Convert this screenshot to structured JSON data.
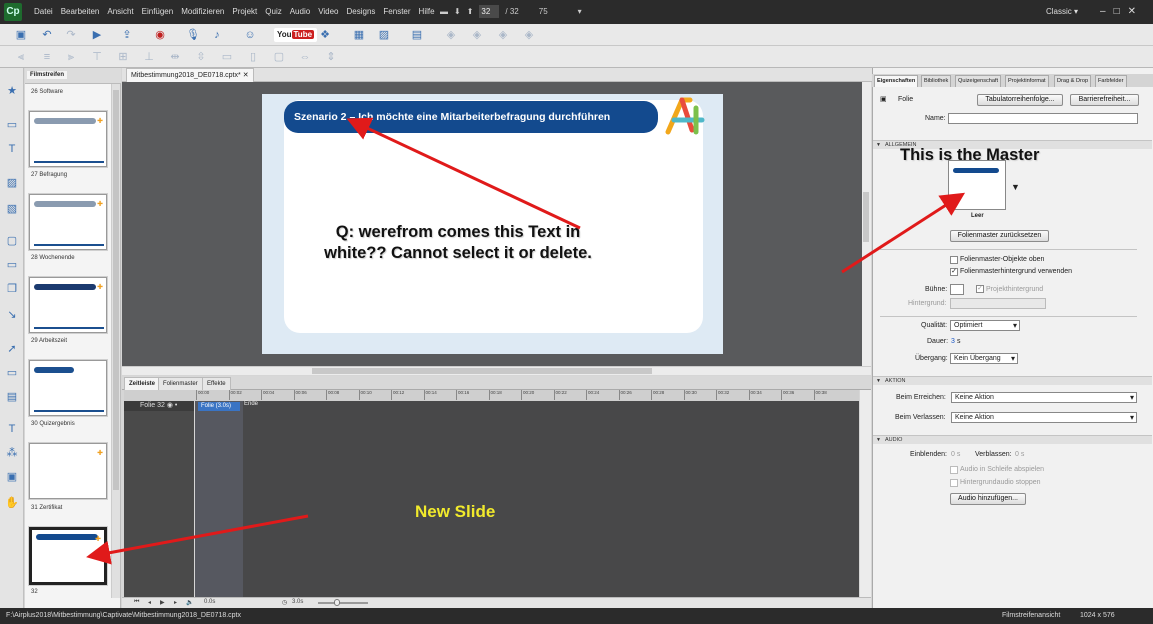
{
  "app": {
    "logo": "Cp",
    "menu": [
      "Datei",
      "Bearbeiten",
      "Ansicht",
      "Einfügen",
      "Modifizieren",
      "Projekt",
      "Quiz",
      "Audio",
      "Video",
      "Designs",
      "Fenster",
      "Hilfe"
    ],
    "current_slide": "32",
    "total_slides": "/ 32",
    "zoom": "75",
    "workspace": "Classic",
    "youtube_label": "You",
    "youtube_badge": "Tube"
  },
  "document_tab": "Mitbestimmung2018_DE0718.cptx*",
  "filmstrip": {
    "tab_label": "Filmstreifen",
    "slides": [
      {
        "label": "26 Software"
      },
      {
        "label": "27 Befragung"
      },
      {
        "label": "28 Wochenende"
      },
      {
        "label": "29 Arbeitszeit"
      },
      {
        "label": "30 Quizergebnis"
      },
      {
        "label": "31 Zertifikat"
      },
      {
        "label": "32"
      }
    ]
  },
  "slide": {
    "header_text": "Szenario 2 – Ich möchte eine Mitarbeiterbefragung durchführen"
  },
  "annotations": {
    "question": "Q: werefrom comes this Text in white?? Cannot select it or delete.",
    "new_slide": "New Slide",
    "master": "This is the Master"
  },
  "timeline": {
    "tabs": [
      "Zeitleiste",
      "Folienmaster",
      "Effekte"
    ],
    "row_label": "Folie 32",
    "slide_item": "Folie (3.0s)",
    "end_label": "Ende",
    "ruler": [
      "00:00",
      "00:02",
      "00:04",
      "00:06",
      "00:08",
      "00:10",
      "00:12",
      "00:14",
      "00:16",
      "00:18",
      "00:20",
      "00:22",
      "00:24",
      "00:26",
      "00:28",
      "00:30",
      "00:32",
      "00:34",
      "00:36",
      "00:38"
    ],
    "time_current": "0.0s",
    "time_total": "3.0s"
  },
  "properties": {
    "tabs": [
      "Eigenschaften",
      "Bibliothek",
      "Quizeigenschaft",
      "Projektinformat",
      "Drag & Drop",
      "Farbfelder"
    ],
    "object_type": "Folie",
    "tab_order_button": "Tabulatorreihenfolge...",
    "accessibility_button": "Barrierefreiheit...",
    "name_label": "Name:",
    "name_value": "",
    "section_general": "ALLGEMEIN",
    "master_name": "Leer",
    "reset_master_button": "Folienmaster zurücksetzen",
    "master_objects_top": "Folienmaster-Objekte oben",
    "use_master_bg": "Folienmasterhintergrund verwenden",
    "stage_label": "Bühne:",
    "project_bg_label": "Projekthintergrund",
    "background_label": "Hintergrund:",
    "quality_label": "Qualität:",
    "quality_value": "Optimiert",
    "duration_label": "Dauer:",
    "duration_value": "3",
    "duration_unit": "s",
    "transition_label": "Übergang:",
    "transition_value": "Kein Übergang",
    "section_action": "AKTION",
    "on_enter_label": "Beim Erreichen:",
    "on_enter_value": "Keine Aktion",
    "on_exit_label": "Beim Verlassen:",
    "on_exit_value": "Keine Aktion",
    "section_audio": "AUDIO",
    "fade_in_label": "Einblenden:",
    "fade_in_value": "0 s",
    "fade_out_label": "Verblassen:",
    "fade_out_value": "0 s",
    "loop_audio": "Audio in Schleife abspielen",
    "stop_bg_audio": "Hintergrundaudio stoppen",
    "add_audio_button": "Audio hinzufügen..."
  },
  "status": {
    "path": "F:\\Airplus2018\\Mitbestimmung\\Captivate\\Mitbestimmung2018_DE0718.cptx",
    "view": "Filmstreifenansicht",
    "resolution": "1024 x 576"
  },
  "colors": {
    "slide_header": "#134a8e",
    "arrow": "#e01a1a",
    "new_slide_text": "#f1ea2c"
  }
}
